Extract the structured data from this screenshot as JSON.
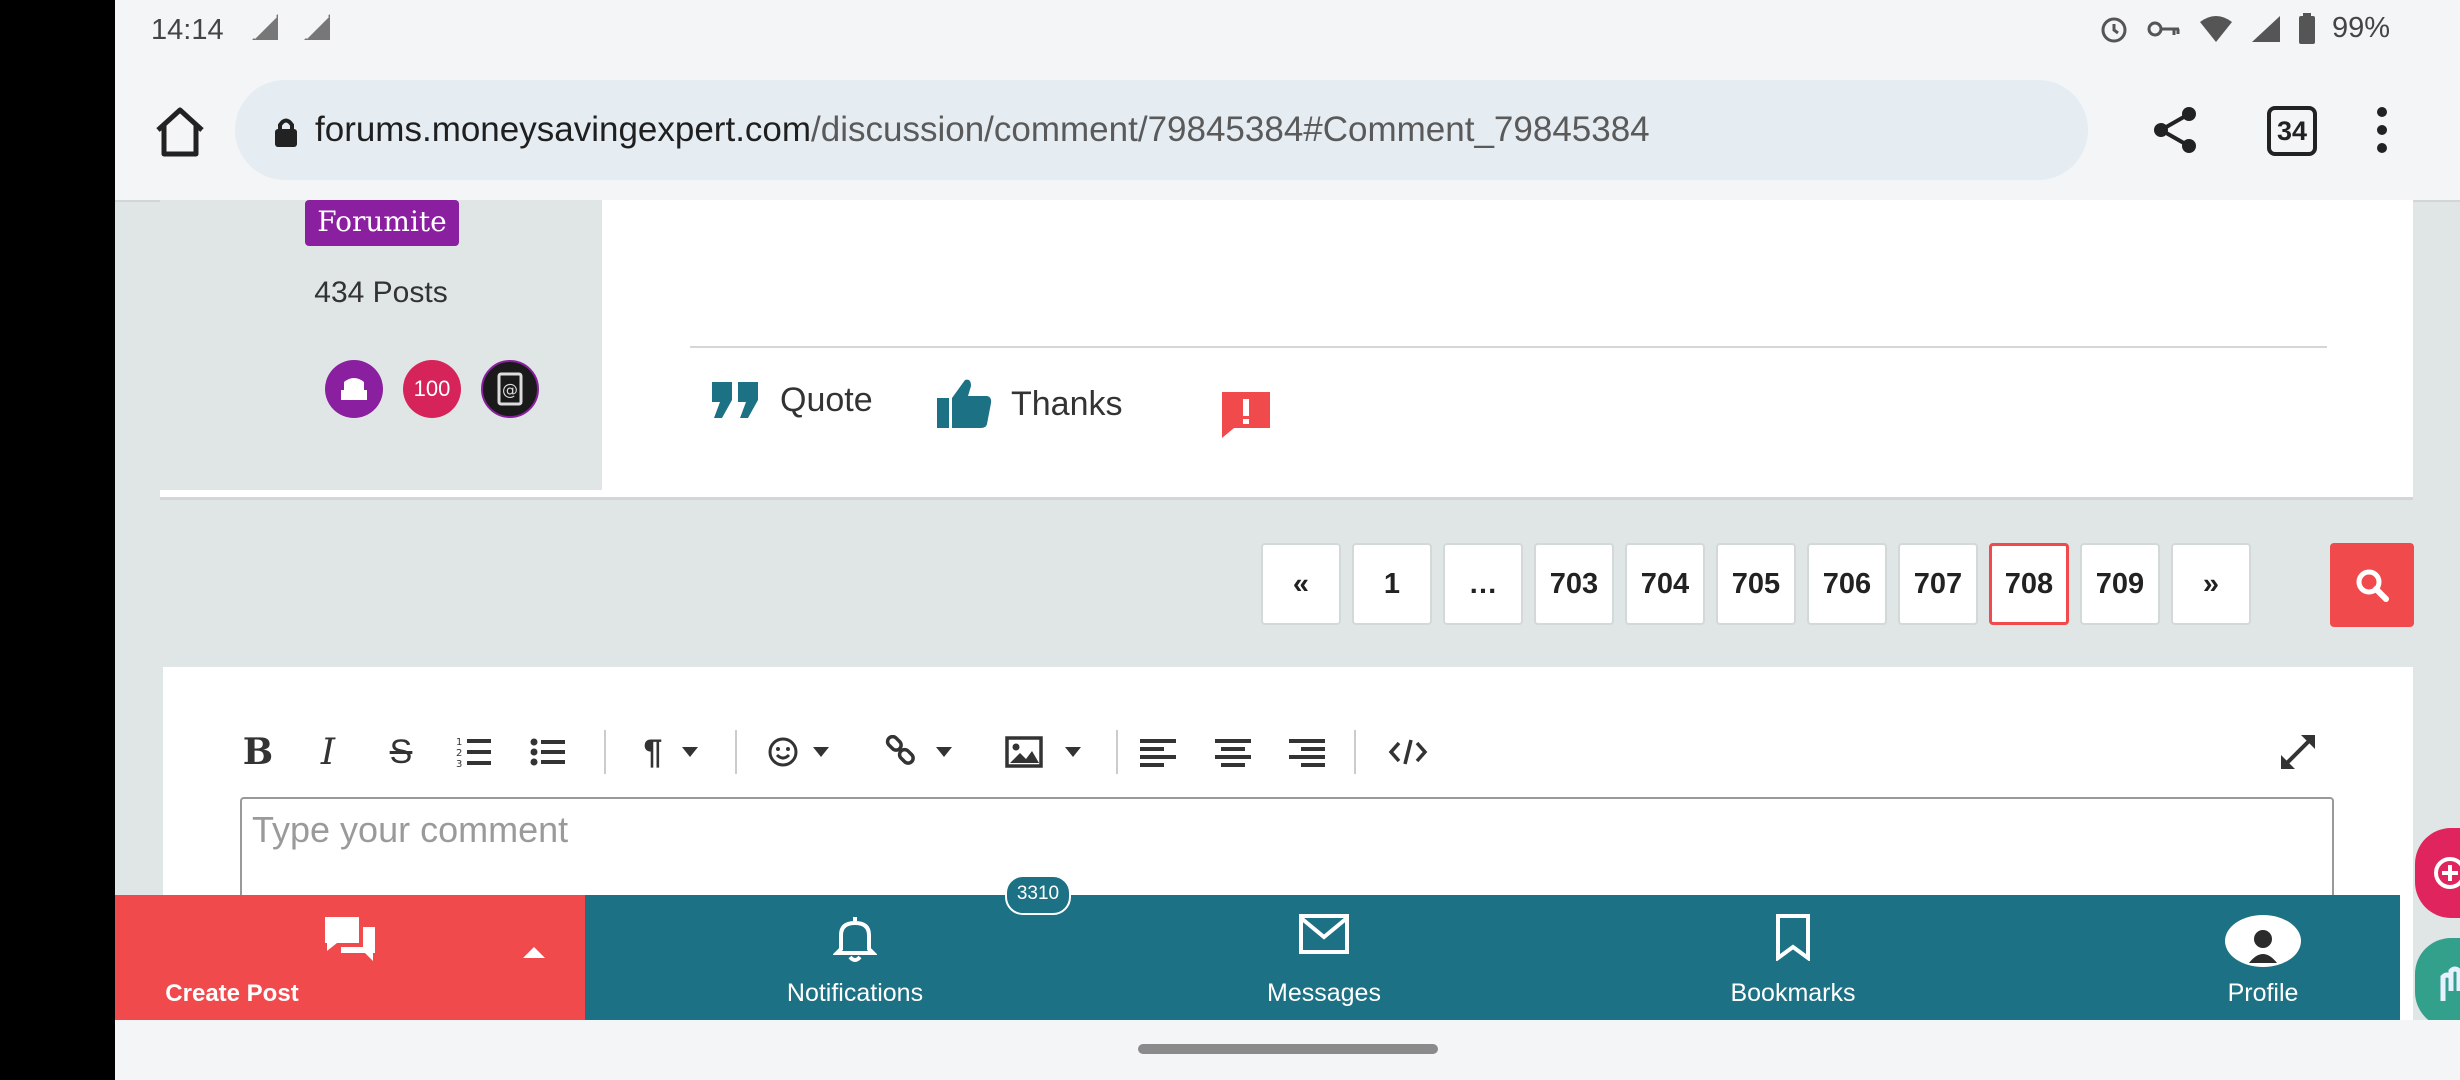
{
  "status_bar": {
    "time": "14:14",
    "battery": "99%"
  },
  "browser": {
    "url_host": "forums.moneysavingexpert.com",
    "url_path": "/discussion/comment/79845384#Comment_79845384",
    "tab_count": "34"
  },
  "post": {
    "rank": "Forumite",
    "post_count": "434 Posts",
    "badges": [
      {
        "name": "armchair-badge",
        "text": "",
        "color": "#8a1f9f"
      },
      {
        "name": "100-badge",
        "text": "100",
        "color": "#d6245a"
      },
      {
        "name": "email-badge",
        "text": "",
        "color": "#1a1a1a"
      }
    ],
    "actions": {
      "quote": "Quote",
      "thanks": "Thanks"
    }
  },
  "pagination": {
    "prev": "«",
    "pages": [
      "1",
      "…",
      "703",
      "704",
      "705",
      "706",
      "707",
      "708",
      "709"
    ],
    "current": "708",
    "next": "»"
  },
  "editor": {
    "placeholder": "Type your comment"
  },
  "bottom_nav": {
    "create_post": "Create Post",
    "notifications": "Notifications",
    "notification_count": "3310",
    "messages": "Messages",
    "bookmarks": "Bookmarks",
    "profile": "Profile"
  },
  "colors": {
    "accent_red": "#f04a4c",
    "nav_teal": "#1c7185",
    "action_teal": "#1c7185",
    "badge_purple": "#8a1f9f"
  }
}
